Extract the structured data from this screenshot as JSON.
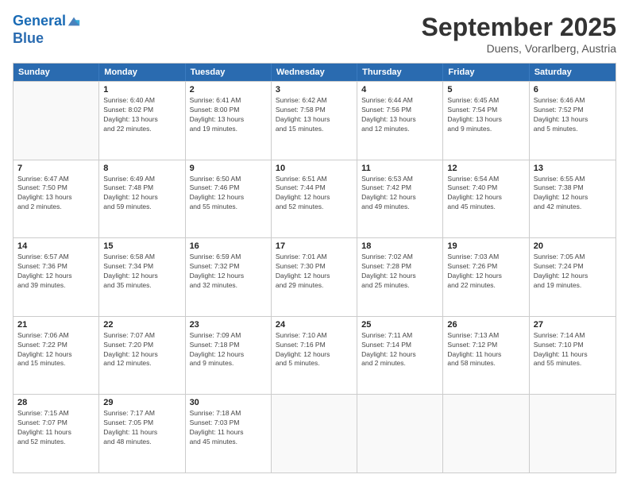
{
  "logo": {
    "line1": "General",
    "line2": "Blue"
  },
  "title": "September 2025",
  "subtitle": "Duens, Vorarlberg, Austria",
  "header_days": [
    "Sunday",
    "Monday",
    "Tuesday",
    "Wednesday",
    "Thursday",
    "Friday",
    "Saturday"
  ],
  "rows": [
    [
      {
        "day": "",
        "info": ""
      },
      {
        "day": "1",
        "info": "Sunrise: 6:40 AM\nSunset: 8:02 PM\nDaylight: 13 hours\nand 22 minutes."
      },
      {
        "day": "2",
        "info": "Sunrise: 6:41 AM\nSunset: 8:00 PM\nDaylight: 13 hours\nand 19 minutes."
      },
      {
        "day": "3",
        "info": "Sunrise: 6:42 AM\nSunset: 7:58 PM\nDaylight: 13 hours\nand 15 minutes."
      },
      {
        "day": "4",
        "info": "Sunrise: 6:44 AM\nSunset: 7:56 PM\nDaylight: 13 hours\nand 12 minutes."
      },
      {
        "day": "5",
        "info": "Sunrise: 6:45 AM\nSunset: 7:54 PM\nDaylight: 13 hours\nand 9 minutes."
      },
      {
        "day": "6",
        "info": "Sunrise: 6:46 AM\nSunset: 7:52 PM\nDaylight: 13 hours\nand 5 minutes."
      }
    ],
    [
      {
        "day": "7",
        "info": "Sunrise: 6:47 AM\nSunset: 7:50 PM\nDaylight: 13 hours\nand 2 minutes."
      },
      {
        "day": "8",
        "info": "Sunrise: 6:49 AM\nSunset: 7:48 PM\nDaylight: 12 hours\nand 59 minutes."
      },
      {
        "day": "9",
        "info": "Sunrise: 6:50 AM\nSunset: 7:46 PM\nDaylight: 12 hours\nand 55 minutes."
      },
      {
        "day": "10",
        "info": "Sunrise: 6:51 AM\nSunset: 7:44 PM\nDaylight: 12 hours\nand 52 minutes."
      },
      {
        "day": "11",
        "info": "Sunrise: 6:53 AM\nSunset: 7:42 PM\nDaylight: 12 hours\nand 49 minutes."
      },
      {
        "day": "12",
        "info": "Sunrise: 6:54 AM\nSunset: 7:40 PM\nDaylight: 12 hours\nand 45 minutes."
      },
      {
        "day": "13",
        "info": "Sunrise: 6:55 AM\nSunset: 7:38 PM\nDaylight: 12 hours\nand 42 minutes."
      }
    ],
    [
      {
        "day": "14",
        "info": "Sunrise: 6:57 AM\nSunset: 7:36 PM\nDaylight: 12 hours\nand 39 minutes."
      },
      {
        "day": "15",
        "info": "Sunrise: 6:58 AM\nSunset: 7:34 PM\nDaylight: 12 hours\nand 35 minutes."
      },
      {
        "day": "16",
        "info": "Sunrise: 6:59 AM\nSunset: 7:32 PM\nDaylight: 12 hours\nand 32 minutes."
      },
      {
        "day": "17",
        "info": "Sunrise: 7:01 AM\nSunset: 7:30 PM\nDaylight: 12 hours\nand 29 minutes."
      },
      {
        "day": "18",
        "info": "Sunrise: 7:02 AM\nSunset: 7:28 PM\nDaylight: 12 hours\nand 25 minutes."
      },
      {
        "day": "19",
        "info": "Sunrise: 7:03 AM\nSunset: 7:26 PM\nDaylight: 12 hours\nand 22 minutes."
      },
      {
        "day": "20",
        "info": "Sunrise: 7:05 AM\nSunset: 7:24 PM\nDaylight: 12 hours\nand 19 minutes."
      }
    ],
    [
      {
        "day": "21",
        "info": "Sunrise: 7:06 AM\nSunset: 7:22 PM\nDaylight: 12 hours\nand 15 minutes."
      },
      {
        "day": "22",
        "info": "Sunrise: 7:07 AM\nSunset: 7:20 PM\nDaylight: 12 hours\nand 12 minutes."
      },
      {
        "day": "23",
        "info": "Sunrise: 7:09 AM\nSunset: 7:18 PM\nDaylight: 12 hours\nand 9 minutes."
      },
      {
        "day": "24",
        "info": "Sunrise: 7:10 AM\nSunset: 7:16 PM\nDaylight: 12 hours\nand 5 minutes."
      },
      {
        "day": "25",
        "info": "Sunrise: 7:11 AM\nSunset: 7:14 PM\nDaylight: 12 hours\nand 2 minutes."
      },
      {
        "day": "26",
        "info": "Sunrise: 7:13 AM\nSunset: 7:12 PM\nDaylight: 11 hours\nand 58 minutes."
      },
      {
        "day": "27",
        "info": "Sunrise: 7:14 AM\nSunset: 7:10 PM\nDaylight: 11 hours\nand 55 minutes."
      }
    ],
    [
      {
        "day": "28",
        "info": "Sunrise: 7:15 AM\nSunset: 7:07 PM\nDaylight: 11 hours\nand 52 minutes."
      },
      {
        "day": "29",
        "info": "Sunrise: 7:17 AM\nSunset: 7:05 PM\nDaylight: 11 hours\nand 48 minutes."
      },
      {
        "day": "30",
        "info": "Sunrise: 7:18 AM\nSunset: 7:03 PM\nDaylight: 11 hours\nand 45 minutes."
      },
      {
        "day": "",
        "info": ""
      },
      {
        "day": "",
        "info": ""
      },
      {
        "day": "",
        "info": ""
      },
      {
        "day": "",
        "info": ""
      }
    ]
  ]
}
